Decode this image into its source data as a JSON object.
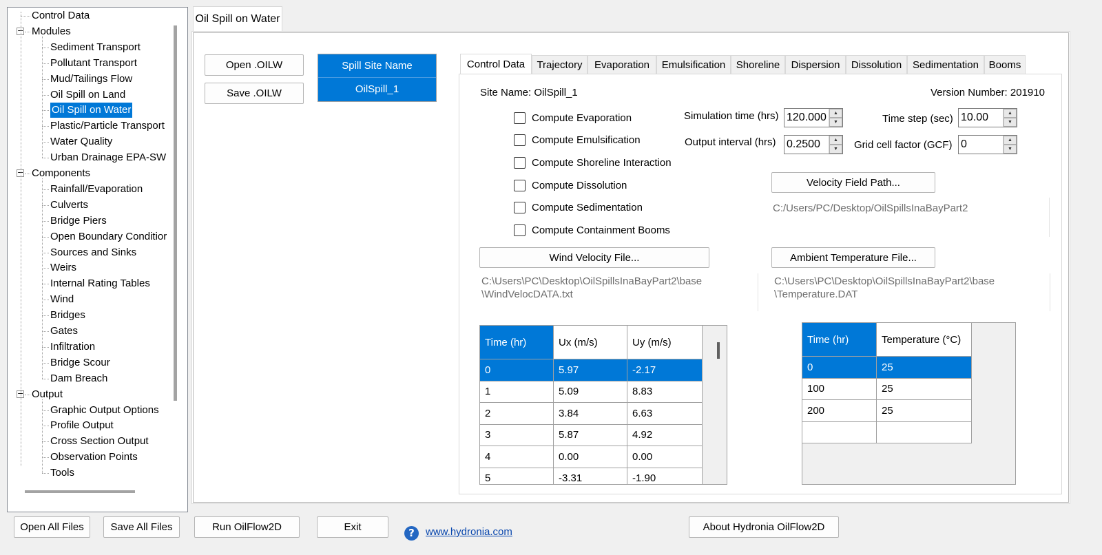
{
  "tree": {
    "items": [
      {
        "label": "Control Data",
        "level": 0
      },
      {
        "label": "Modules",
        "level": 0,
        "expander": "-"
      },
      {
        "label": "Sediment Transport",
        "level": 1
      },
      {
        "label": "Pollutant Transport",
        "level": 1
      },
      {
        "label": "Mud/Tailings Flow",
        "level": 1
      },
      {
        "label": "Oil Spill on Land",
        "level": 1
      },
      {
        "label": "Oil Spill on Water",
        "level": 1,
        "selected": true
      },
      {
        "label": "Plastic/Particle Transport",
        "level": 1
      },
      {
        "label": "Water Quality",
        "level": 1
      },
      {
        "label": "Urban Drainage EPA-SW",
        "level": 1
      },
      {
        "label": "Components",
        "level": 0,
        "expander": "-"
      },
      {
        "label": "Rainfall/Evaporation",
        "level": 1
      },
      {
        "label": "Culverts",
        "level": 1
      },
      {
        "label": "Bridge Piers",
        "level": 1
      },
      {
        "label": "Open Boundary Conditior",
        "level": 1
      },
      {
        "label": "Sources and Sinks",
        "level": 1
      },
      {
        "label": "Weirs",
        "level": 1
      },
      {
        "label": "Internal Rating Tables",
        "level": 1
      },
      {
        "label": "Wind",
        "level": 1
      },
      {
        "label": "Bridges",
        "level": 1
      },
      {
        "label": "Gates",
        "level": 1
      },
      {
        "label": "Infiltration",
        "level": 1
      },
      {
        "label": "Bridge Scour",
        "level": 1
      },
      {
        "label": "Dam Breach",
        "level": 1
      },
      {
        "label": "Output",
        "level": 0,
        "expander": "-"
      },
      {
        "label": "Graphic Output Options",
        "level": 1
      },
      {
        "label": "Profile Output",
        "level": 1
      },
      {
        "label": "Cross Section Output",
        "level": 1
      },
      {
        "label": "Observation Points",
        "level": 1
      },
      {
        "label": "Tools",
        "level": 1
      }
    ]
  },
  "main_tab": {
    "label": "Oil Spill on Water"
  },
  "buttons": {
    "open_oilw": "Open .OILW",
    "save_oilw": "Save .OILW",
    "velocity_field": "Velocity Field Path...",
    "wind_velocity": "Wind Velocity File...",
    "ambient_temp": "Ambient Temperature File..."
  },
  "spill_site": {
    "header": "Spill Site Name",
    "value": "OilSpill_1"
  },
  "inner_tabs": [
    "Control Data",
    "Trajectory",
    "Evaporation",
    "Emulsification",
    "Shoreline",
    "Dispersion",
    "Dissolution",
    "Sedimentation",
    "Booms"
  ],
  "control": {
    "site_name": "Site Name: OilSpill_1",
    "version": "Version Number: 201910",
    "checkboxes": [
      "Compute Evaporation",
      "Compute Emulsification",
      "Compute Shoreline Interaction",
      "Compute Dissolution",
      "Compute Sedimentation",
      "Compute Containment Booms"
    ],
    "sim_time_label": "Simulation time (hrs)",
    "sim_time_value": "120.000",
    "output_interval_label": "Output interval (hrs)",
    "output_interval_value": "0.2500",
    "time_step_label": "Time step (sec)",
    "time_step_value": "10.00",
    "gcf_label": "Grid cell factor (GCF)",
    "gcf_value": "0",
    "velocity_path": "C:/Users/PC/Desktop/OilSpillsInaBayPart2",
    "wind_path_1": "C:\\Users\\PC\\Desktop\\OilSpillsInaBayPart2\\base",
    "wind_path_2": "\\WindVelocDATA.txt",
    "temp_path_1": "C:\\Users\\PC\\Desktop\\OilSpillsInaBayPart2\\base",
    "temp_path_2": "\\Temperature.DAT"
  },
  "wind_table": {
    "headers": [
      "Time (hr)",
      "Ux (m/s)",
      "Uy (m/s)"
    ],
    "rows": [
      [
        "0",
        "5.97",
        "-2.17"
      ],
      [
        "1",
        "5.09",
        "8.83"
      ],
      [
        "2",
        "3.84",
        "6.63"
      ],
      [
        "3",
        "5.87",
        "4.92"
      ],
      [
        "4",
        "0.00",
        "0.00"
      ],
      [
        "5",
        "-3.31",
        "-1.90"
      ]
    ]
  },
  "temp_table": {
    "headers": [
      "Time (hr)",
      "Temperature (°C)"
    ],
    "rows": [
      [
        "0",
        "25"
      ],
      [
        "100",
        "25"
      ],
      [
        "200",
        "25"
      ],
      [
        "",
        ""
      ]
    ]
  },
  "footer": {
    "open_all": "Open All Files",
    "save_all": "Save All Files",
    "run": "Run OilFlow2D",
    "exit": "Exit",
    "link": "www.hydronia.com",
    "about": "About Hydronia OilFlow2D"
  }
}
